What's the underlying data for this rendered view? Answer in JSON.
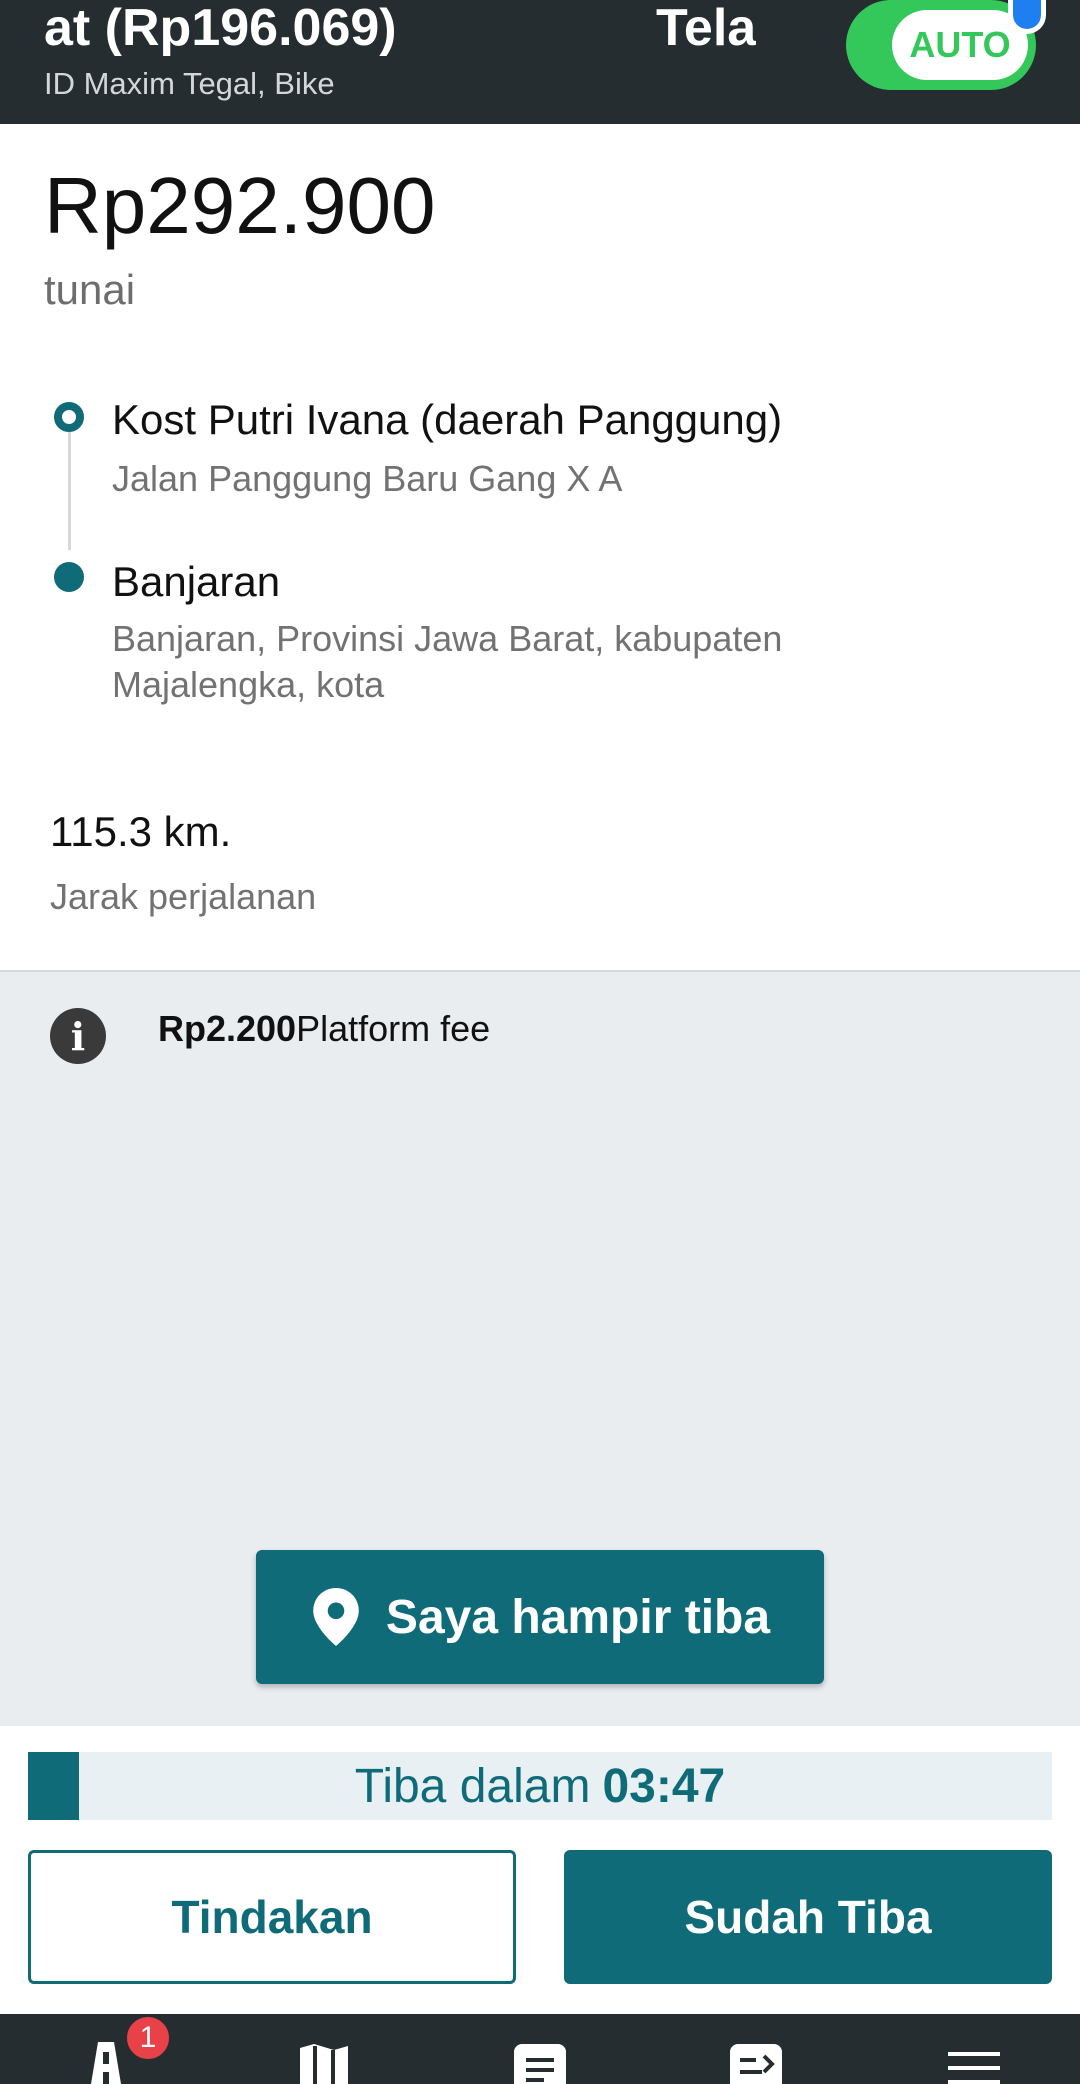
{
  "header": {
    "title_left": "at (Rp196.069)",
    "title_right": "Tela",
    "subtitle": "ID Maxim Tegal, Bike",
    "toggle_label": "AUTO",
    "toggle_on": true
  },
  "order": {
    "price": "Rp292.900",
    "payment_method": "tunai",
    "pickup": {
      "name": "Kost Putri Ivana (daerah Panggung)",
      "address": "Jalan Panggung Baru Gang X A"
    },
    "dropoff": {
      "name": "Banjaran",
      "address": "Banjaran, Provinsi Jawa Barat, kabupaten Majalengka, kota"
    },
    "distance": "115.3 km.",
    "distance_label": "Jarak perjalanan"
  },
  "fee": {
    "amount": "Rp2.200",
    "label": "Platform fee"
  },
  "actions": {
    "near_label": "Saya hampir tiba",
    "timer_prefix": "Tiba dalam",
    "timer_value": "03:47",
    "timer_progress": 0.05,
    "secondary_label": "Tindakan",
    "primary_label": "Sudah Tiba"
  },
  "bottom_nav": {
    "badge_count": "1",
    "items": [
      "road-icon",
      "map-icon",
      "list-icon",
      "chat-icon",
      "menu-icon"
    ]
  },
  "colors": {
    "primary": "#0f6b78",
    "header_bg": "#262d31",
    "toggle_green": "#34c759",
    "badge_red": "#e84148"
  }
}
